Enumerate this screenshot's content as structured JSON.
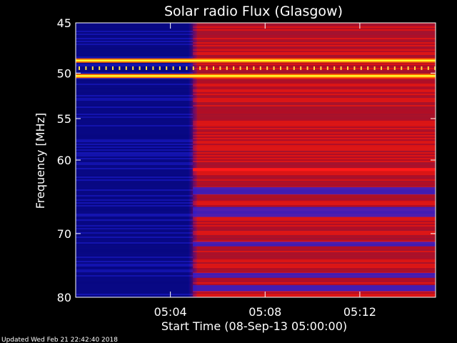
{
  "chart_data": {
    "type": "heatmap",
    "title": "Solar radio Flux (Glasgow)",
    "xlabel": "Start Time (08-Sep-13 05:00:00)",
    "ylabel": "Frequency [MHz]",
    "x_unit": "minutes after 05:00",
    "xlim": [
      0,
      15.2
    ],
    "ylim": [
      45,
      80
    ],
    "x_ticks": [
      {
        "value": 4,
        "label": "05:04"
      },
      {
        "value": 8,
        "label": "05:08"
      },
      {
        "value": 12,
        "label": "05:12"
      }
    ],
    "y_ticks": [
      {
        "value": 45,
        "label": "45"
      },
      {
        "value": 50,
        "label": "50"
      },
      {
        "value": 55,
        "label": "55"
      },
      {
        "value": 60,
        "label": "60"
      },
      {
        "value": 70,
        "label": "70"
      },
      {
        "value": 80,
        "label": "80"
      }
    ],
    "y_scale": "log",
    "colormap": [
      "#0000ff",
      "#ff0000",
      "#ffff00"
    ],
    "regions": [
      {
        "x_start": 0,
        "x_end": 4.95,
        "intensity": "low",
        "color": "#0a0a8c"
      },
      {
        "x_start": 4.95,
        "x_end": 15.2,
        "intensity": "moderate",
        "color": "#c81010"
      }
    ],
    "bright_bands": [
      {
        "freq": 48.7,
        "intensity": "high"
      },
      {
        "freq": 50.3,
        "intensity": "high"
      }
    ]
  },
  "footer": {
    "updated": "Updated Wed Feb 21 22:42:40 2018"
  }
}
